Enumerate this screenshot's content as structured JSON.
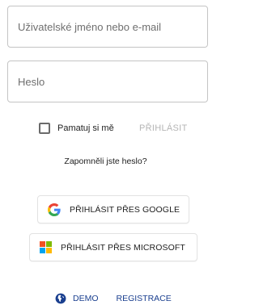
{
  "login_form": {
    "username": {
      "placeholder": "Uživatelské jméno nebo e-mail",
      "value": ""
    },
    "password": {
      "placeholder": "Heslo",
      "value": ""
    },
    "remember_me": {
      "label": "Pamatuj si mě",
      "checked": false
    },
    "login_button": {
      "label": "PŘIHLÁSIT",
      "enabled": false
    },
    "forgot_password_link": "Zapomněli jste heslo?"
  },
  "sso": {
    "google": {
      "label": "PŘIHLÁSIT PŘES GOOGLE",
      "icon": "google-g-icon"
    },
    "microsoft": {
      "label": "PŘIHLÁSIT PŘES MICROSOFT",
      "icon": "microsoft-logo-icon"
    }
  },
  "footer": {
    "demo_label": "DEMO",
    "demo_icon": "globe-icon",
    "register_label": "REGISTRACE"
  },
  "colors": {
    "link": "#1a3f8f",
    "disabled_text": "#b5b5b5",
    "border": "#c4c4c4",
    "google_blue": "#4285F4",
    "google_red": "#EA4335",
    "google_yellow": "#FBBC05",
    "google_green": "#34A853",
    "ms_red": "#F25022",
    "ms_green": "#7FBA00",
    "ms_blue": "#00A4EF",
    "ms_yellow": "#FFB900"
  }
}
